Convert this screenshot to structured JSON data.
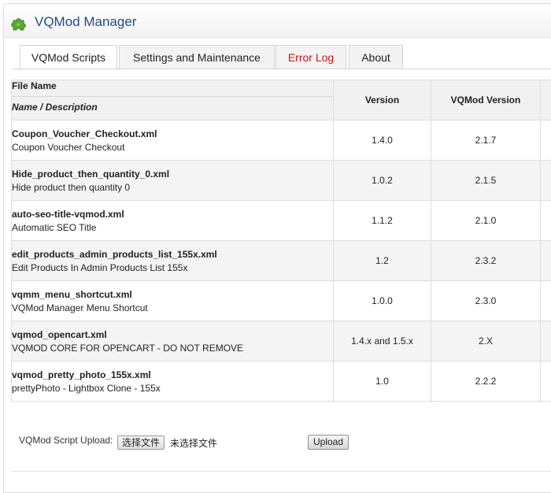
{
  "header": {
    "title": "VQMod Manager",
    "icon": "puzzle-icon",
    "icon_color": "#5aa932"
  },
  "tabs": [
    {
      "label": "VQMod Scripts",
      "active": true
    },
    {
      "label": "Settings and Maintenance",
      "active": false
    },
    {
      "label": "Error Log",
      "active": false,
      "color": "#d0131b"
    },
    {
      "label": "About",
      "active": false
    }
  ],
  "table": {
    "columns": {
      "file_name": "File Name",
      "name_description": "Name / Description",
      "version": "Version",
      "vqmod_version": "VQMod Version"
    },
    "rows": [
      {
        "file": "Coupon_Voucher_Checkout.xml",
        "description": "Coupon Voucher Checkout",
        "version": "1.4.0",
        "vqmod_version": "2.1.7"
      },
      {
        "file": "Hide_product_then_quantity_0.xml",
        "description": "Hide product then quantity 0",
        "version": "1.0.2",
        "vqmod_version": "2.1.5"
      },
      {
        "file": "auto-seo-title-vqmod.xml",
        "description": "Automatic SEO Title",
        "version": "1.1.2",
        "vqmod_version": "2.1.0"
      },
      {
        "file": "edit_products_admin_products_list_155x.xml",
        "description": "Edit Products In Admin Products List 155x",
        "version": "1.2",
        "vqmod_version": "2.3.2"
      },
      {
        "file": "vqmm_menu_shortcut.xml",
        "description": "VQMod Manager Menu Shortcut",
        "version": "1.0.0",
        "vqmod_version": "2.3.0"
      },
      {
        "file": "vqmod_opencart.xml",
        "description": "VQMOD CORE FOR OPENCART - DO NOT REMOVE",
        "version": "1.4.x and 1.5.x",
        "vqmod_version": "2.X"
      },
      {
        "file": "vqmod_pretty_photo_155x.xml",
        "description": "prettyPhoto - Lightbox Clone - 155x",
        "version": "1.0",
        "vqmod_version": "2.2.2"
      }
    ]
  },
  "upload": {
    "label": "VQMod Script Upload:",
    "choose_file": "选择文件",
    "no_file": "未选择文件",
    "button": "Upload"
  }
}
